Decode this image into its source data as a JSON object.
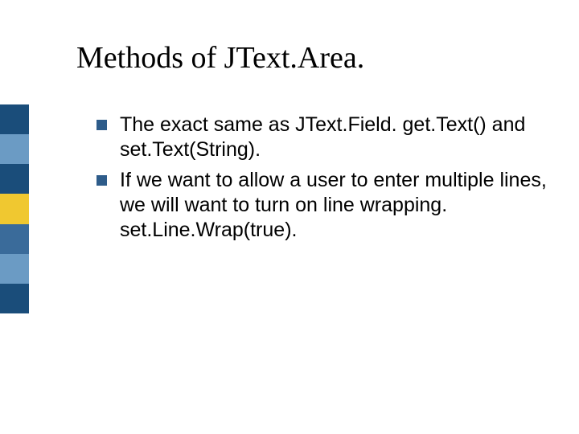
{
  "sidebar": {
    "colors": [
      "#1a4d7a",
      "#6b9bc4",
      "#1a4d7a",
      "#f0c830",
      "#3a6b9a",
      "#6b9bc4",
      "#1a4d7a"
    ]
  },
  "title": "Methods of JText.Area.",
  "bullets": [
    {
      "text": "The exact same as JText.Field. get.Text() and set.Text(String)."
    },
    {
      "text": "If we want to allow a user to enter multiple lines, we will want to turn on line wrapping. set.Line.Wrap(true)."
    }
  ]
}
